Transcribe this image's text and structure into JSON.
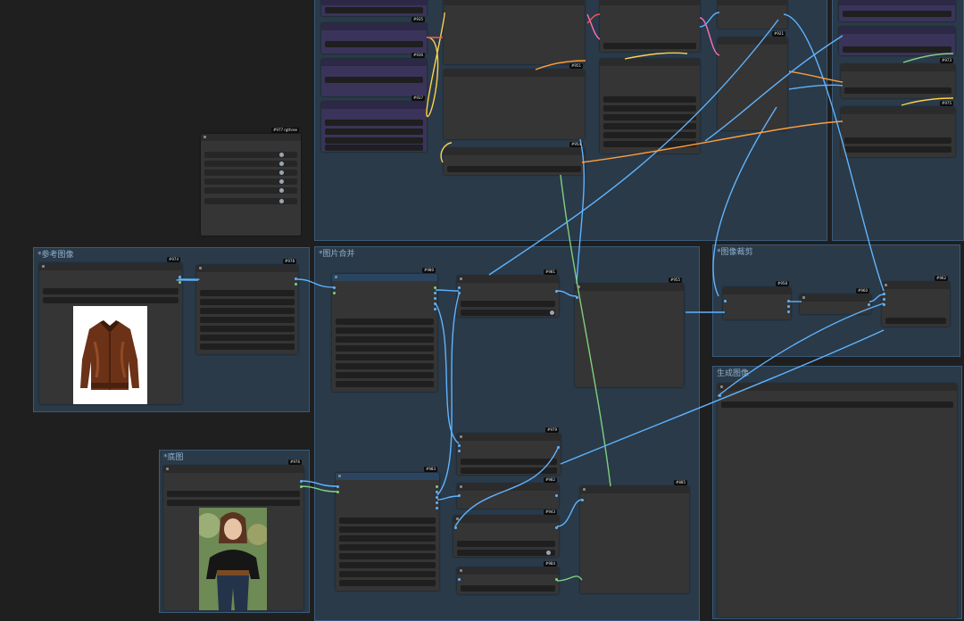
{
  "groups": {
    "reference_image": "*参考图像",
    "base_image": "*底图",
    "image_merge": "*图片合并",
    "image_crop": "*图像裁剪",
    "generated_image": "生成图像"
  },
  "node_ids": {
    "n977": "#977 rgthree",
    "n974": "#974",
    "n978": "#978",
    "n976": "#976",
    "n981": "#981",
    "n955": "#955",
    "n980": "#980",
    "n979": "#979",
    "n983": "#983",
    "n982": "#982",
    "n943": "#943",
    "n984": "#984",
    "n885": "#885",
    "n958": "#958",
    "n960": "#960",
    "n962": "#962",
    "n931": "#931",
    "n935": "#935",
    "n936": "#936",
    "n937": "#937",
    "n951": "#951",
    "n954": "#954",
    "n938": "#938",
    "n921": "#921",
    "n927": "#927",
    "n973": "#973",
    "n975": "#975"
  },
  "colors": {
    "canvas": "#1f1f1f",
    "group_fill": "#2a3a48",
    "node": "#353535",
    "wire_blue": "#5fb3ff",
    "wire_orange": "#ff9d3c",
    "wire_green": "#7fd07f",
    "wire_yellow": "#ffd24a"
  },
  "images": {
    "reference": "brown-leather-jacket",
    "base": "woman-in-black-sweater"
  }
}
